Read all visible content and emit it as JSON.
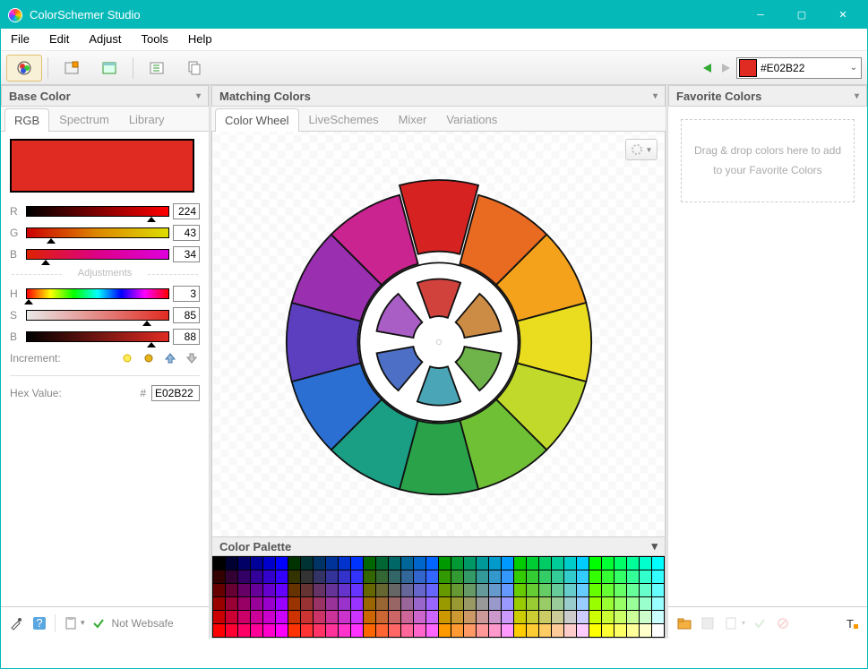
{
  "titlebar": {
    "title": "ColorSchemer Studio"
  },
  "menubar": [
    "File",
    "Edit",
    "Adjust",
    "Tools",
    "Help"
  ],
  "toolbar": {
    "current_hex": "#E02B22",
    "swatch_color": "#E02B22"
  },
  "left_panel": {
    "header": "Base Color",
    "tabs": [
      "RGB",
      "Spectrum",
      "Library"
    ],
    "active_tab": 0,
    "big_swatch": "#E02B22",
    "rgb": {
      "R": "224",
      "G": "43",
      "B": "34"
    },
    "adjustments_label": "Adjustments",
    "hsb": {
      "H": "3",
      "S": "85",
      "B": "88"
    },
    "increment_label": "Increment:",
    "hex_label": "Hex Value:",
    "hex_value": "E02B22",
    "websafe_msg": "Not Websafe"
  },
  "mid_panel": {
    "header": "Matching Colors",
    "tabs": [
      "Color Wheel",
      "LiveSchemes",
      "Mixer",
      "Variations"
    ],
    "active_tab": 0,
    "wheel_colors": [
      "#d72222",
      "#e96a21",
      "#f4a21b",
      "#eadd1f",
      "#c1d92a",
      "#6fc035",
      "#29a24a",
      "#1a9f84",
      "#2a6fd1",
      "#5b3fbf",
      "#9a2fb0",
      "#c9248f"
    ],
    "inner_colors": [
      "#d1423d",
      "#cd8c45",
      "#6eb44a",
      "#4aa6b7",
      "#4e6fc6",
      "#a85ec5"
    ],
    "palette_header": "Color Palette"
  },
  "palette_cells": [
    "#000000",
    "#000033",
    "#000066",
    "#000099",
    "#0000CC",
    "#0000FF",
    "#003300",
    "#003333",
    "#003366",
    "#003399",
    "#0033CC",
    "#0033FF",
    "#006600",
    "#006633",
    "#006666",
    "#006699",
    "#0066CC",
    "#0066FF",
    "#009900",
    "#009933",
    "#009966",
    "#009999",
    "#0099CC",
    "#0099FF",
    "#00CC00",
    "#00CC33",
    "#00CC66",
    "#00CC99",
    "#00CCCC",
    "#00CCFF",
    "#00FF00",
    "#00FF33",
    "#00FF66",
    "#00FF99",
    "#00FFCC",
    "#00FFFF",
    "#330000",
    "#330033",
    "#330066",
    "#330099",
    "#3300CC",
    "#3300FF",
    "#333300",
    "#333333",
    "#333366",
    "#333399",
    "#3333CC",
    "#3333FF",
    "#336600",
    "#336633",
    "#336666",
    "#336699",
    "#3366CC",
    "#3366FF",
    "#339900",
    "#339933",
    "#339966",
    "#339999",
    "#3399CC",
    "#3399FF",
    "#33CC00",
    "#33CC33",
    "#33CC66",
    "#33CC99",
    "#33CCCC",
    "#33CCFF",
    "#33FF00",
    "#33FF33",
    "#33FF66",
    "#33FF99",
    "#33FFCC",
    "#33FFFF",
    "#660000",
    "#660033",
    "#660066",
    "#660099",
    "#6600CC",
    "#6600FF",
    "#663300",
    "#663333",
    "#663366",
    "#663399",
    "#6633CC",
    "#6633FF",
    "#666600",
    "#666633",
    "#666666",
    "#666699",
    "#6666CC",
    "#6666FF",
    "#669900",
    "#669933",
    "#669966",
    "#669999",
    "#6699CC",
    "#6699FF",
    "#66CC00",
    "#66CC33",
    "#66CC66",
    "#66CC99",
    "#66CCCC",
    "#66CCFF",
    "#66FF00",
    "#66FF33",
    "#66FF66",
    "#66FF99",
    "#66FFCC",
    "#66FFFF",
    "#990000",
    "#990033",
    "#990066",
    "#990099",
    "#9900CC",
    "#9900FF",
    "#993300",
    "#993333",
    "#993366",
    "#993399",
    "#9933CC",
    "#9933FF",
    "#996600",
    "#996633",
    "#996666",
    "#996699",
    "#9966CC",
    "#9966FF",
    "#999900",
    "#999933",
    "#999966",
    "#999999",
    "#9999CC",
    "#9999FF",
    "#99CC00",
    "#99CC33",
    "#99CC66",
    "#99CC99",
    "#99CCCC",
    "#99CCFF",
    "#99FF00",
    "#99FF33",
    "#99FF66",
    "#99FF99",
    "#99FFCC",
    "#99FFFF",
    "#CC0000",
    "#CC0033",
    "#CC0066",
    "#CC0099",
    "#CC00CC",
    "#CC00FF",
    "#CC3300",
    "#CC3333",
    "#CC3366",
    "#CC3399",
    "#CC33CC",
    "#CC33FF",
    "#CC6600",
    "#CC6633",
    "#CC6666",
    "#CC6699",
    "#CC66CC",
    "#CC66FF",
    "#CC9900",
    "#CC9933",
    "#CC9966",
    "#CC9999",
    "#CC99CC",
    "#CC99FF",
    "#CCCC00",
    "#CCCC33",
    "#CCCC66",
    "#CCCC99",
    "#CCCCCC",
    "#CCCCFF",
    "#CCFF00",
    "#CCFF33",
    "#CCFF66",
    "#CCFF99",
    "#CCFFCC",
    "#CCFFFF",
    "#FF0000",
    "#FF0033",
    "#FF0066",
    "#FF0099",
    "#FF00CC",
    "#FF00FF",
    "#FF3300",
    "#FF3333",
    "#FF3366",
    "#FF3399",
    "#FF33CC",
    "#FF33FF",
    "#FF6600",
    "#FF6633",
    "#FF6666",
    "#FF6699",
    "#FF66CC",
    "#FF66FF",
    "#FF9900",
    "#FF9933",
    "#FF9966",
    "#FF9999",
    "#FF99CC",
    "#FF99FF",
    "#FFCC00",
    "#FFCC33",
    "#FFCC66",
    "#FFCC99",
    "#FFCCCC",
    "#FFCCFF",
    "#FFFF00",
    "#FFFF33",
    "#FFFF66",
    "#FFFF99",
    "#FFFFCC",
    "#FFFFFF"
  ],
  "right_panel": {
    "header": "Favorite Colors",
    "drop_msg": "Drag & drop colors here to add to your Favorite Colors"
  }
}
